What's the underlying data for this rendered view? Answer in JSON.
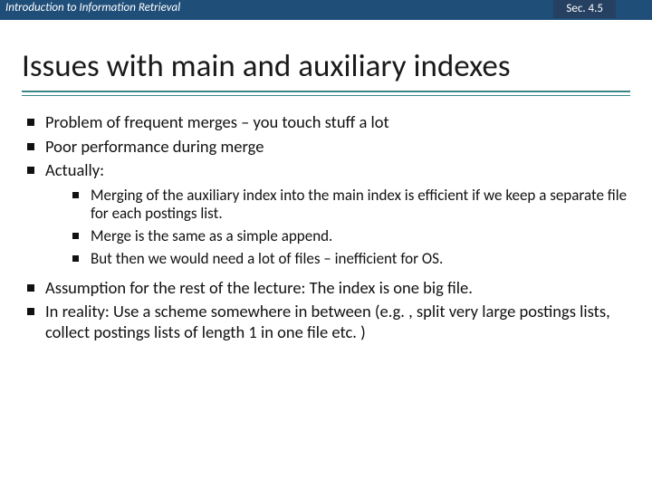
{
  "header": {
    "left": "Introduction to Information Retrieval",
    "right": "Sec. 4.5"
  },
  "title": "Issues with main and auxiliary indexes",
  "bullets_top": [
    "Problem of frequent merges – you touch stuff a lot",
    "Poor performance during merge",
    "Actually:"
  ],
  "bullets_sub": [
    "Merging of the auxiliary index into the main index is efficient if we keep a separate file for each postings list.",
    "Merge is the same as a simple append.",
    "But then we would need a lot of files – inefficient for OS."
  ],
  "bullets_bottom": [
    "Assumption for the rest of the lecture: The index is one big file.",
    "In reality: Use a scheme somewhere in between (e.g. , split very large postings lists, collect postings lists of length 1 in one file etc. )"
  ]
}
